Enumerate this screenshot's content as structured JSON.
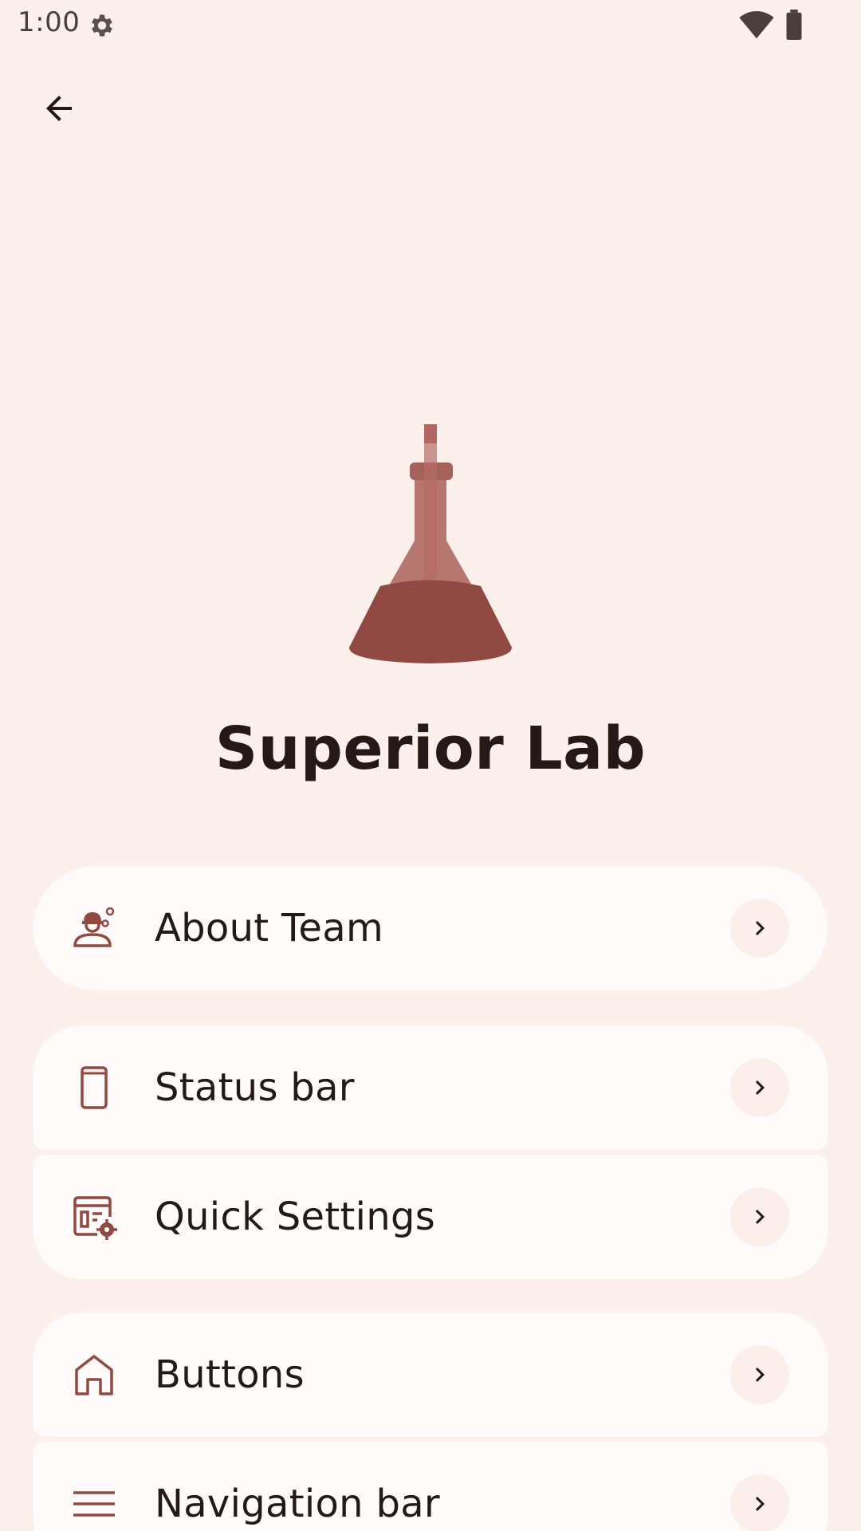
{
  "status_bar": {
    "time": "1:00",
    "icons": [
      "settings-gear-icon",
      "wifi-icon",
      "battery-icon"
    ]
  },
  "header": {
    "back_icon": "arrow-back-icon"
  },
  "hero": {
    "icon": "flask-icon",
    "title": "Superior Lab"
  },
  "menu": {
    "items": [
      {
        "label": "About Team",
        "icon": "engineering-icon"
      },
      {
        "label": "Status bar",
        "icon": "smartphone-icon"
      },
      {
        "label": "Quick Settings",
        "icon": "tile-settings-icon"
      },
      {
        "label": "Buttons",
        "icon": "home-icon"
      },
      {
        "label": "Navigation bar",
        "icon": "menu-lines-icon"
      }
    ]
  },
  "colors": {
    "background": "#fcf0ed",
    "card": "#fffbfa",
    "accent": "#904a42",
    "text": "#231918"
  }
}
